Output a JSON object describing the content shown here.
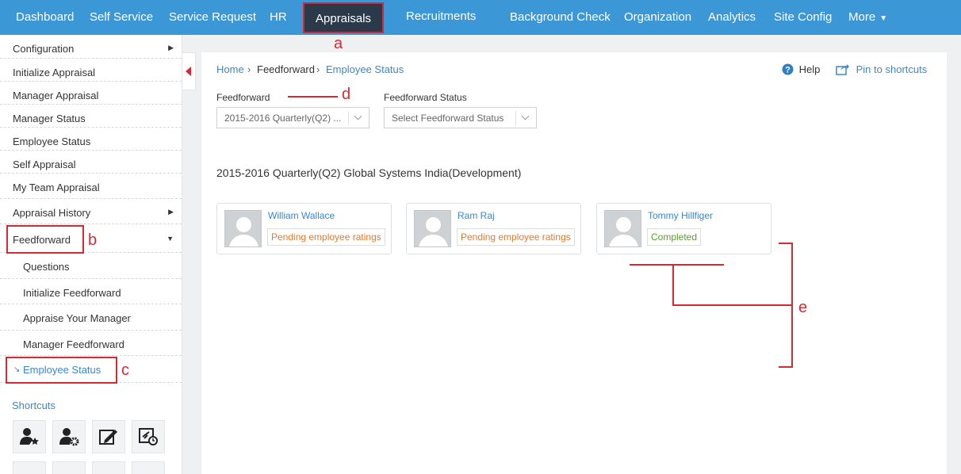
{
  "nav": {
    "items": [
      "Dashboard",
      "Self Service",
      "Service Request",
      "HR",
      "Appraisals",
      "Recruitments",
      "Background Check",
      "Organization",
      "Analytics",
      "Site Config",
      "More"
    ],
    "active": "Appraisals"
  },
  "sidebar": {
    "items": [
      {
        "label": "Configuration",
        "has_arrow": true
      },
      {
        "label": "Initialize Appraisal"
      },
      {
        "label": "Manager Appraisal"
      },
      {
        "label": "Manager Status"
      },
      {
        "label": "Employee Status"
      },
      {
        "label": "Self Appraisal"
      },
      {
        "label": "My Team Appraisal"
      },
      {
        "label": "Appraisal History",
        "has_arrow": true
      },
      {
        "label": "Feedforward",
        "expanded": true
      },
      {
        "label": "Questions"
      },
      {
        "label": "Initialize Feedforward"
      },
      {
        "label": "Appraise Your Manager"
      },
      {
        "label": "Manager Feedforward"
      },
      {
        "label": "Employee Status",
        "active": true
      }
    ],
    "shortcuts_title": "Shortcuts",
    "shortcut_icons": [
      "user-star-icon",
      "user-gear-icon",
      "edit-document-icon",
      "travel-clock-icon"
    ]
  },
  "breadcrumb": {
    "home": "Home",
    "section": "Feedforward",
    "current": "Employee Status"
  },
  "header_links": {
    "help": "Help",
    "pin": "Pin to shortcuts"
  },
  "filters": {
    "feedforward_label": "Feedforward",
    "feedforward_value": "2015-2016 Quarterly(Q2) ...",
    "status_label": "Feedforward Status",
    "status_placeholder": "Select Feedforward Status"
  },
  "section_title": "2015-2016 Quarterly(Q2) Global Systems India(Development)",
  "employees": [
    {
      "name": "William Wallace",
      "status": "Pending employee ratings",
      "status_color": "#e07a2e"
    },
    {
      "name": "Ram Raj",
      "status": "Pending employee ratings",
      "status_color": "#e07a2e"
    },
    {
      "name": "Tommy Hillfiger",
      "status": "Completed",
      "status_color": "#5aa02c"
    }
  ],
  "annotations": {
    "a": "a",
    "b": "b",
    "c": "c",
    "d": "d",
    "e": "e"
  },
  "colors": {
    "nav_bg": "#3c97d6",
    "active_nav_bg": "#2b3a4a",
    "link": "#3c87c8",
    "annotation": "#d42a33"
  }
}
